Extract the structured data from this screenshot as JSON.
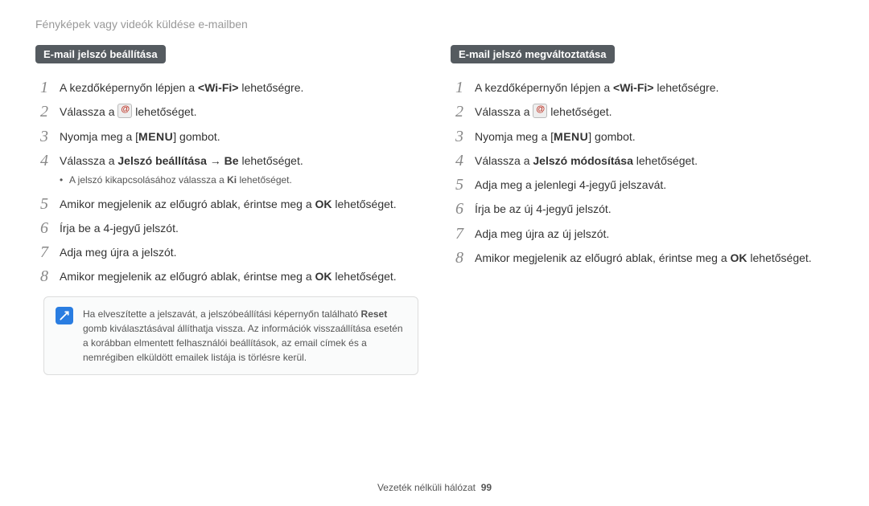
{
  "page_title": "Fényképek vagy videók küldése e-mailben",
  "left": {
    "header": "E-mail jelszó beállítása",
    "steps": [
      {
        "html": "A kezdőképernyőn lépjen a <b>&lt;Wi-Fi&gt;</b> lehetőségre."
      },
      {
        "html": "Válassza a {EMAIL_ICON} lehetőséget."
      },
      {
        "html": "Nyomja meg a [<span class='menu-key'>MENU</span>] gombot."
      },
      {
        "html": "Válassza a <b>Jelszó beállítása</b> → <b>Be</b> lehetőséget.",
        "sub": "A jelszó kikapcsolásához válassza a <b>Ki</b> lehetőséget."
      },
      {
        "html": "Amikor megjelenik az előugró ablak, érintse meg a <b>OK</b> lehetőséget."
      },
      {
        "html": "Írja be a 4-jegyű jelszót."
      },
      {
        "html": "Adja meg újra a jelszót."
      },
      {
        "html": "Amikor megjelenik az előugró ablak, érintse meg a <b>OK</b> lehetőséget."
      }
    ]
  },
  "right": {
    "header": "E-mail jelszó megváltoztatása",
    "steps": [
      {
        "html": "A kezdőképernyőn lépjen a <b>&lt;Wi-Fi&gt;</b> lehetőségre."
      },
      {
        "html": "Válassza a {EMAIL_ICON} lehetőséget."
      },
      {
        "html": "Nyomja meg a [<span class='menu-key'>MENU</span>] gombot."
      },
      {
        "html": "Válassza a <b>Jelszó módosítása</b> lehetőséget."
      },
      {
        "html": "Adja meg a jelenlegi 4-jegyű jelszavát."
      },
      {
        "html": "Írja be az új 4-jegyű jelszót."
      },
      {
        "html": "Adja meg újra az új jelszót."
      },
      {
        "html": "Amikor megjelenik az előugró ablak, érintse meg a <b>OK</b> lehetőséget."
      }
    ]
  },
  "callout": {
    "icon_label": "note-icon",
    "html": "Ha elveszítette a jelszavát, a jelszóbeállítási képernyőn található <b>Reset</b> gomb kiválasztásával állíthatja vissza. Az információk visszaállítása esetén a korábban elmentett felhasználói beállítások, az email címek és a nemrégiben elküldött emailek listája is törlésre kerül."
  },
  "footer": {
    "section": "Vezeték nélküli hálózat",
    "page": "99"
  }
}
